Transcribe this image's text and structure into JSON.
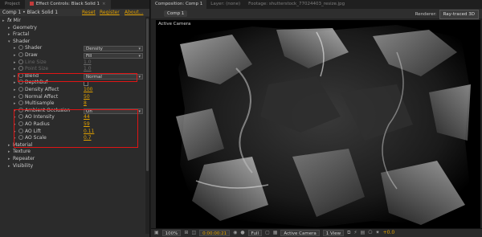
{
  "left_panel": {
    "tabs": [
      "Project",
      "Effect Controls: Black Solid 1"
    ],
    "comp_path": "Comp 1 • Black Solid 1",
    "links": {
      "reset": "Reset",
      "register": "Register",
      "about": "About..."
    },
    "rows": [
      {
        "label": "Mir",
        "kind": "group",
        "indent": 0,
        "fx": true
      },
      {
        "label": "Geometry",
        "kind": "group",
        "indent": 1
      },
      {
        "label": "Fractal",
        "kind": "group",
        "indent": 1
      },
      {
        "label": "Shader",
        "kind": "group",
        "indent": 1,
        "open": true
      },
      {
        "label": "Shader",
        "kind": "select",
        "indent": 2,
        "value": "Density"
      },
      {
        "label": "Draw",
        "kind": "select",
        "indent": 2,
        "value": "Fill"
      },
      {
        "label": "Line Size",
        "kind": "value",
        "indent": 2,
        "value": "1.0",
        "dim": true
      },
      {
        "label": "Point Size",
        "kind": "value",
        "indent": 2,
        "value": "1.0",
        "dim": true
      },
      {
        "label": "Blend",
        "kind": "select",
        "indent": 2,
        "value": "Normal"
      },
      {
        "label": "DepthBuf",
        "kind": "check",
        "indent": 2
      },
      {
        "label": "Density Affect",
        "kind": "value",
        "indent": 2,
        "value": "100"
      },
      {
        "label": "Normal Affect",
        "kind": "value",
        "indent": 2,
        "value": "50"
      },
      {
        "label": "Multisample",
        "kind": "value",
        "indent": 2,
        "value": "8"
      },
      {
        "label": "Ambient Occlusion",
        "kind": "select",
        "indent": 2,
        "value": "On"
      },
      {
        "label": "AO Intensity",
        "kind": "value",
        "indent": 2,
        "value": "44"
      },
      {
        "label": "AO Radius",
        "kind": "value",
        "indent": 2,
        "value": "59"
      },
      {
        "label": "AO Lift",
        "kind": "value",
        "indent": 2,
        "value": "0.11"
      },
      {
        "label": "AO Scale",
        "kind": "value",
        "indent": 2,
        "value": "0.7"
      },
      {
        "label": "Material",
        "kind": "group",
        "indent": 1
      },
      {
        "label": "Texture",
        "kind": "group",
        "indent": 1
      },
      {
        "label": "Repeater",
        "kind": "group",
        "indent": 1
      },
      {
        "label": "Visibility",
        "kind": "group",
        "indent": 1
      }
    ]
  },
  "right_panel": {
    "tabs": [
      "Composition: Comp 1",
      "Layer: (none)",
      "Footage: shutterstock_77024403_resize.jpg"
    ],
    "comp_tab": "Comp 1",
    "renderer_label": "Renderer:",
    "renderer_value": "Ray-traced 3D",
    "camera_label": "Active Camera"
  },
  "bottom_bar": {
    "zoom": "100%",
    "timecode": "0:00:00:21",
    "resolution": "Full",
    "camera": "Active Camera",
    "views": "1 View",
    "exposure": "+0.0"
  },
  "colors": {
    "highlight_box": "#e01515",
    "value_orange": "#e0a000"
  }
}
